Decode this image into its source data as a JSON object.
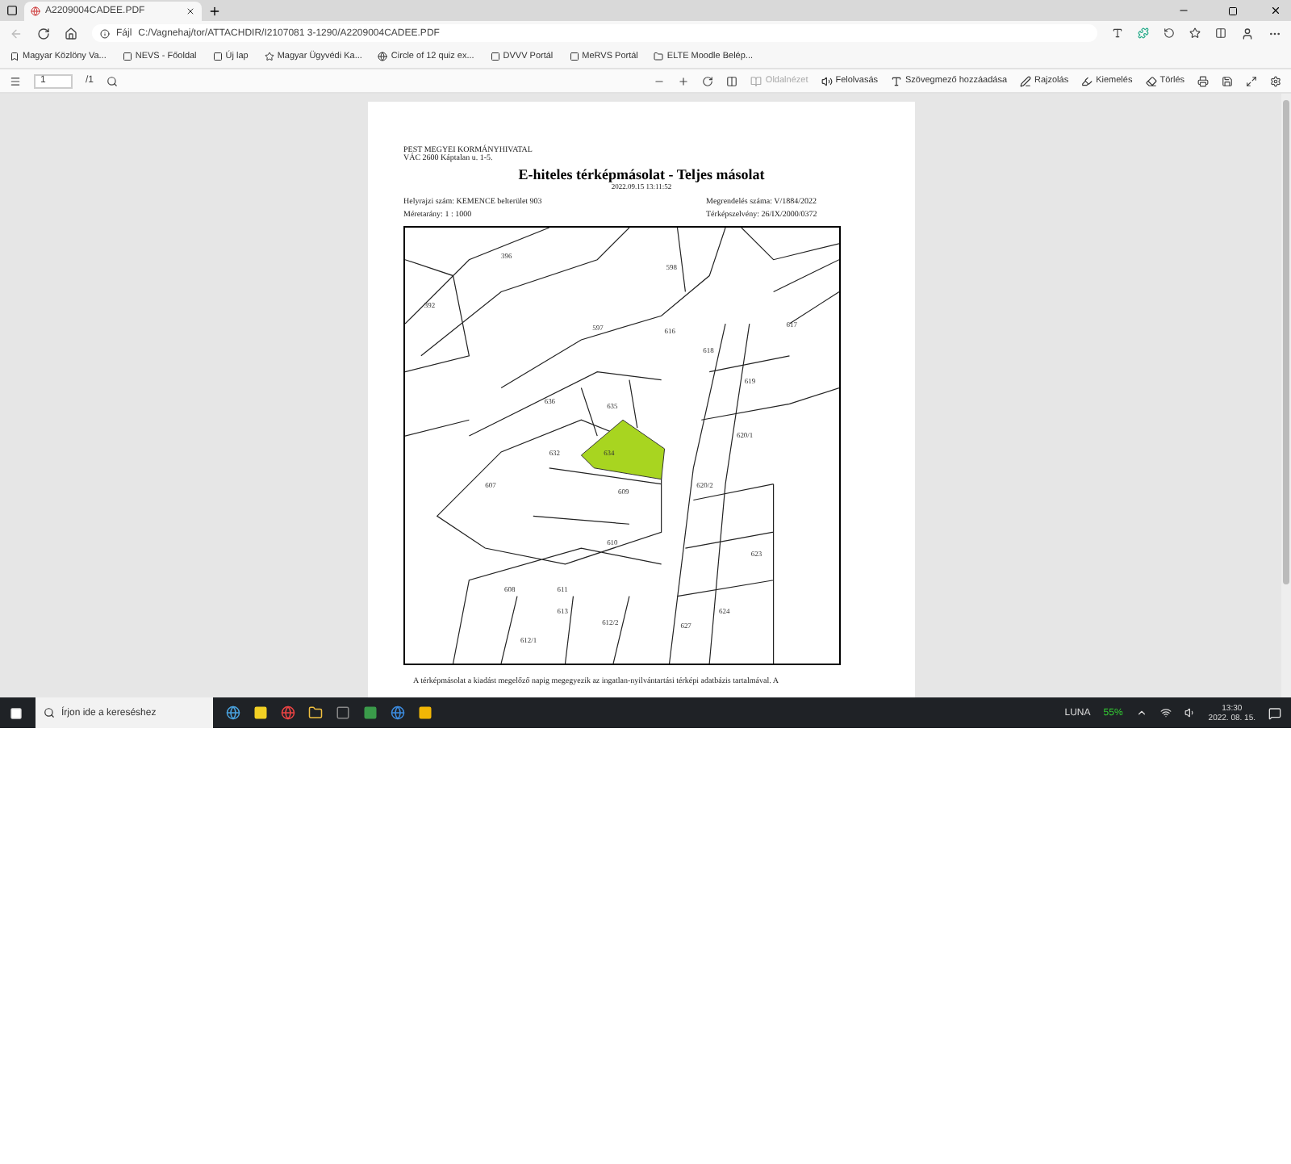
{
  "browser": {
    "tabs": [
      {
        "title": "A2209004CADEE.PDF",
        "selected": true
      }
    ],
    "address": {
      "scheme": "Fájl",
      "url": "C:/Vagnehaj/tor/ATTACHDIR/I2107081 3-1290/A2209004CADEE.PDF"
    },
    "bookmarks": [
      "Magyar Közlöny Va...",
      "NEVS - Főoldal",
      "Új lap",
      "Magyar Ügyvédi Ka...",
      "Circle of 12 quiz ex...",
      "DVVV Portál",
      "MeRVS Portál",
      "ELTE Moodle Belép..."
    ]
  },
  "pdf_toolbar": {
    "page": "1",
    "page_count": "/1",
    "tools": [
      {
        "label": "Oldalnézet",
        "disabled": true
      },
      {
        "label": "Felolvasás",
        "disabled": false
      },
      {
        "label": "Szövegmező hozzáadása",
        "disabled": false
      },
      {
        "label": "Rajzolás",
        "disabled": false
      },
      {
        "label": "Kiemelés",
        "disabled": false
      },
      {
        "label": "Törlés",
        "disabled": false
      }
    ]
  },
  "document": {
    "office": "PEST MEGYEI KORMÁNYHIVATAL",
    "address": "VÁC 2600 Káptalan u. 1-5.",
    "title": "E-hiteles térképmásolat - Teljes másolat",
    "timestamp": "2022.09.15 13:11:52",
    "fields": [
      {
        "label": "Helyrajzi szám:",
        "value": "KEMENCE belterület 903"
      },
      {
        "label": "Megrendelés száma:",
        "value": "V/1884/2022"
      },
      {
        "label": "Méretarány:",
        "value": "1 : 1000"
      },
      {
        "label": "Térképszelvény:",
        "value": "26/IX/2000/0372"
      }
    ],
    "map_labels": [
      "396",
      "392",
      "598",
      "597",
      "616",
      "617",
      "618",
      "619",
      "636",
      "635",
      "634",
      "632",
      "620/1",
      "620/2",
      "607",
      "609",
      "610",
      "608",
      "611",
      "613",
      "612/2",
      "612/1",
      "627",
      "624",
      "623"
    ],
    "note": "A térképmásolat a kiadást megelőző napig megegyezik az ingatlan-nyilvántartási térképi adatbázis tartalmával. A"
  },
  "taskbar": {
    "search_placeholder": "Írjon ide a kereséshez",
    "tray": {
      "ticker": "LUNA",
      "change": "55%",
      "time": "13:30",
      "date": "2022. 08. 15."
    }
  }
}
